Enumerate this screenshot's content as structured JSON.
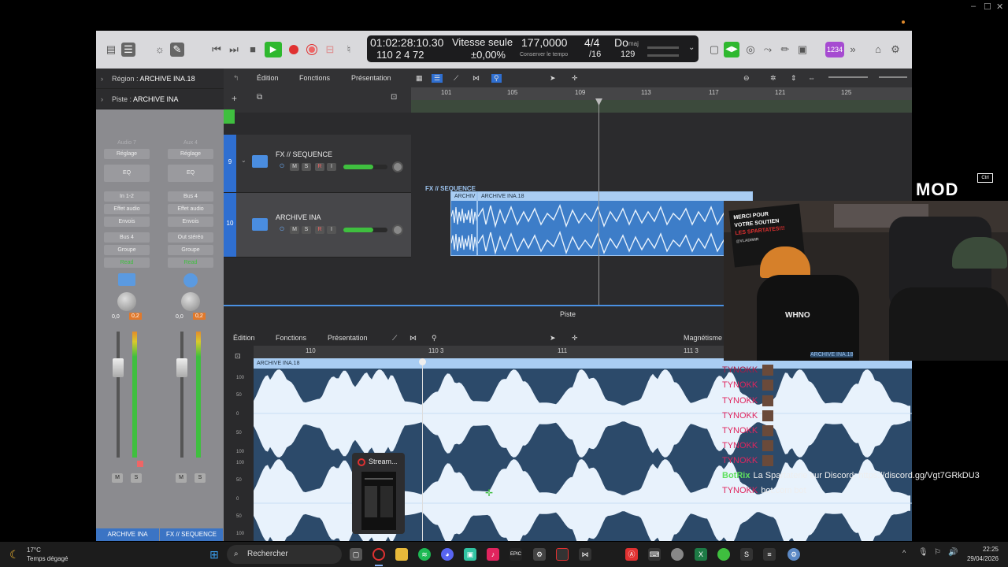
{
  "window_controls": {
    "minimize": "–",
    "maximize": "☐",
    "close": "✕"
  },
  "control_bar": {
    "time_code": "01:02:28:10.30",
    "position": "110  2  4    72",
    "mode_label": "Vitesse seule",
    "tempo_pct": "±0,00%",
    "tempo": "177,0000",
    "tempo_sub": "Conserver le tempo",
    "signature": "4/4",
    "division": "/16",
    "key": "Do",
    "key_mode": "maj",
    "key_value": "129",
    "purple_label": "1234",
    "accent_green": "#2eb82e",
    "accent_red": "#e03131"
  },
  "inspector": {
    "region_label": "Région :",
    "region_name": "ARCHIVE INA.18",
    "track_label": "Piste :",
    "track_name": "ARCHIVE INA",
    "strips": [
      {
        "header": "Audio 7",
        "setting": "Réglage",
        "eq": "EQ",
        "input": "In 1-2",
        "effect": "Effet audio",
        "sends": "Envois",
        "output": "Bus 4",
        "group": "Groupe",
        "mode": "Read",
        "vol_left": "0,0",
        "vol_right": "0,2",
        "mute": "M",
        "solo": "S",
        "name": "ARCHIVE INA"
      },
      {
        "header": "Aux 4",
        "setting": "Réglage",
        "eq": "EQ",
        "input": "Bus 4",
        "effect": "Effet audio",
        "sends": "Envois",
        "output": "Out stéréo",
        "group": "Groupe",
        "mode": "Read",
        "vol_left": "0,0",
        "vol_right": "0,2",
        "mute": "M",
        "solo": "S",
        "name": "FX // SEQUENCE"
      }
    ]
  },
  "tracks_area": {
    "menu": [
      "Édition",
      "Fonctions",
      "Présentation"
    ],
    "ruler": [
      "101",
      "105",
      "109",
      "113",
      "117",
      "121",
      "125"
    ],
    "tracks": [
      {
        "number": "9",
        "name": "FX // SEQUENCE",
        "region_label": "FX // SEQUENCE"
      },
      {
        "number": "10",
        "name": "ARCHIVE INA",
        "region_short": "ARCHIV",
        "region_label": "ARCHIVE INA.18"
      }
    ],
    "mute": "M",
    "solo": "S",
    "rec": "R",
    "input": "I"
  },
  "editor": {
    "title": "Piste",
    "menu": [
      "Édition",
      "Fonctions",
      "Présentation"
    ],
    "snap_label": "Magnétisme",
    "ruler": [
      "110",
      "110 3",
      "111",
      "111 3"
    ],
    "region_label": "ARCHIVE INA.18",
    "scale": [
      "100",
      "50",
      "0",
      "50",
      "100",
      "100",
      "50",
      "0",
      "50",
      "100"
    ]
  },
  "overlay": {
    "mod_badge": "MOD",
    "ctrl_key": "Ctrl",
    "banner_lines": [
      "MERCI POUR",
      "VOTRE SOUTIEN",
      "LES SPARTATES!!!",
      "@VLADIMIR"
    ],
    "webcam_region_label": "ARCHIVE INA.18"
  },
  "chat": [
    {
      "user": "TYNOKK",
      "message": ""
    },
    {
      "user": "TYNOKK",
      "message": ""
    },
    {
      "user": "TYNOKK",
      "message": ""
    },
    {
      "user": "TYNOKK",
      "message": ""
    },
    {
      "user": "TYNOKK",
      "message": ""
    },
    {
      "user": "TYNOKK",
      "message": ""
    },
    {
      "user": "TYNOKK",
      "message": ""
    },
    {
      "user": "BotRix",
      "message": "La Spartaterie sur Discord: https://discord.gg/Vgt7GRkDU3"
    },
    {
      "user": "TYNOKK",
      "message": "bot.com bot"
    }
  ],
  "stream_thumb": {
    "label": "Stream..."
  },
  "taskbar": {
    "temp": "17°C",
    "weather": "Temps dégagé",
    "search_placeholder": "Rechercher",
    "time": "22:25",
    "date": "29/04/2026",
    "apps": [
      "windows-start",
      "task-view",
      "opera-gx",
      "file-explorer",
      "spotify",
      "discord",
      "streamlabs",
      "tiktok",
      "epic-games",
      "steam",
      "screen-recorder",
      "capcut",
      "adobe",
      "keyboard",
      "app-shield",
      "excel",
      "vpn",
      "starsector",
      "obs-notes",
      "settings"
    ]
  }
}
